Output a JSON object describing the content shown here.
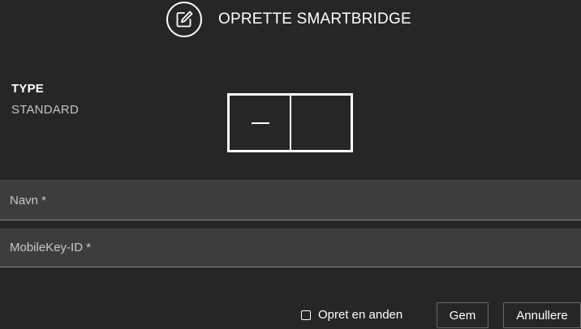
{
  "header": {
    "icon": "edit-icon",
    "title": "OPRETTE SMARTBRIDGE"
  },
  "type": {
    "label": "TYPE",
    "value": "STANDARD"
  },
  "device": {
    "icon": "smartbridge-device-icon"
  },
  "form": {
    "name_placeholder": "Navn *",
    "name_value": "",
    "mobilekey_placeholder": "MobileKey-ID *",
    "mobilekey_value": ""
  },
  "footer": {
    "create_another_label": "Opret en anden",
    "create_another_checked": false,
    "save_label": "Gem",
    "cancel_label": "Annullere"
  }
}
